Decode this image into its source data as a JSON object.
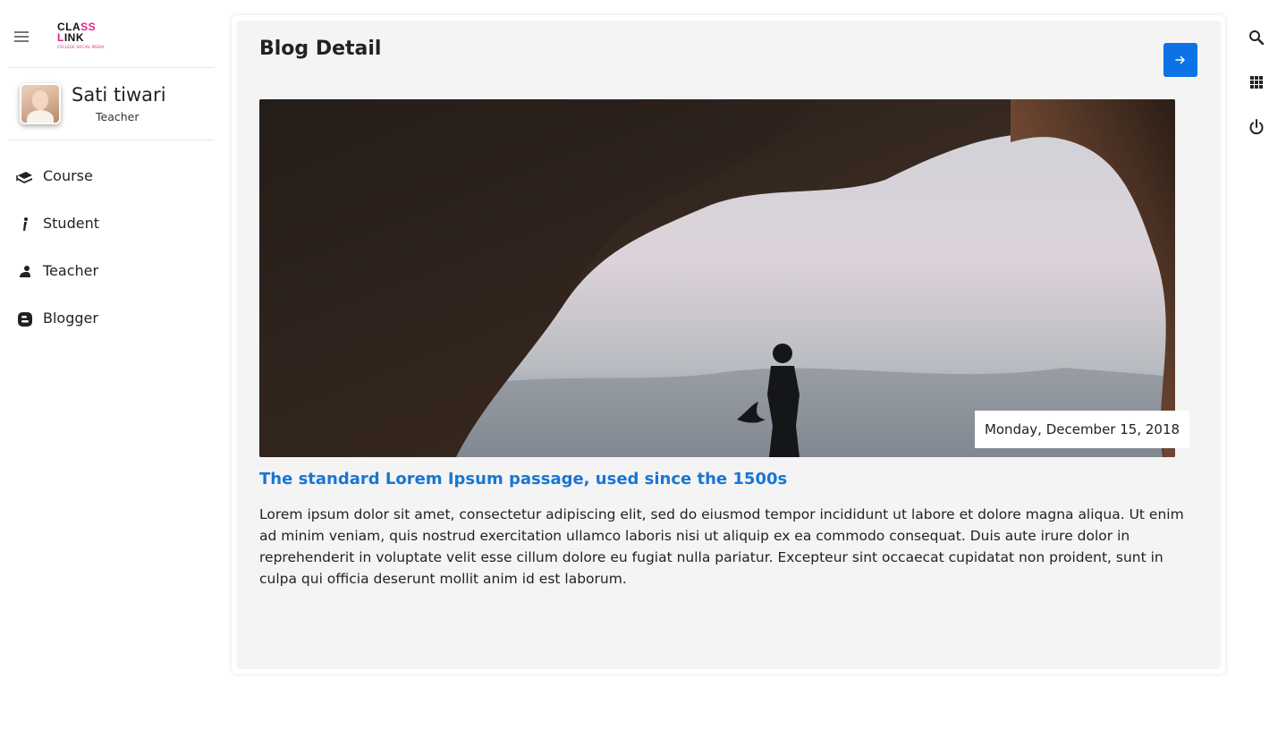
{
  "app": {
    "logo": {
      "line1_a": "CLA",
      "line1_b": "SS",
      "line2_a": "L",
      "line2_b": "INK",
      "tagline": "COLLEGE SOCIAL MEDIA"
    }
  },
  "profile": {
    "name": "Sati tiwari",
    "role": "Teacher"
  },
  "sidebar": {
    "items": [
      {
        "label": "Course",
        "icon": "book-stack-icon"
      },
      {
        "label": "Student",
        "icon": "student-icon"
      },
      {
        "label": "Teacher",
        "icon": "teacher-icon"
      },
      {
        "label": "Blogger",
        "icon": "blogger-icon"
      }
    ]
  },
  "main": {
    "title": "Blog Detail",
    "post": {
      "date": "Monday, December 15, 2018",
      "title": "The standard Lorem Ipsum passage, used since the 1500s",
      "body": "Lorem ipsum dolor sit amet, consectetur adipiscing elit, sed do eiusmod tempor incididunt ut labore et dolore magna aliqua. Ut enim ad minim veniam, quis nostrud exercitation ullamco laboris nisi ut aliquip ex ea commodo consequat. Duis aute irure dolor in reprehenderit in voluptate velit esse cillum dolore eu fugiat nulla pariatur. Excepteur sint occaecat cupidatat non proident, sunt in culpa qui officia deserunt mollit anim id est laborum."
    }
  },
  "rail": {
    "icons": [
      "search-icon",
      "apps-grid-icon",
      "power-icon"
    ]
  },
  "colors": {
    "accent": "#0b73e6",
    "link": "#1976d2",
    "card_bg": "#f4f4f4",
    "logo_accent": "#e0218a"
  }
}
